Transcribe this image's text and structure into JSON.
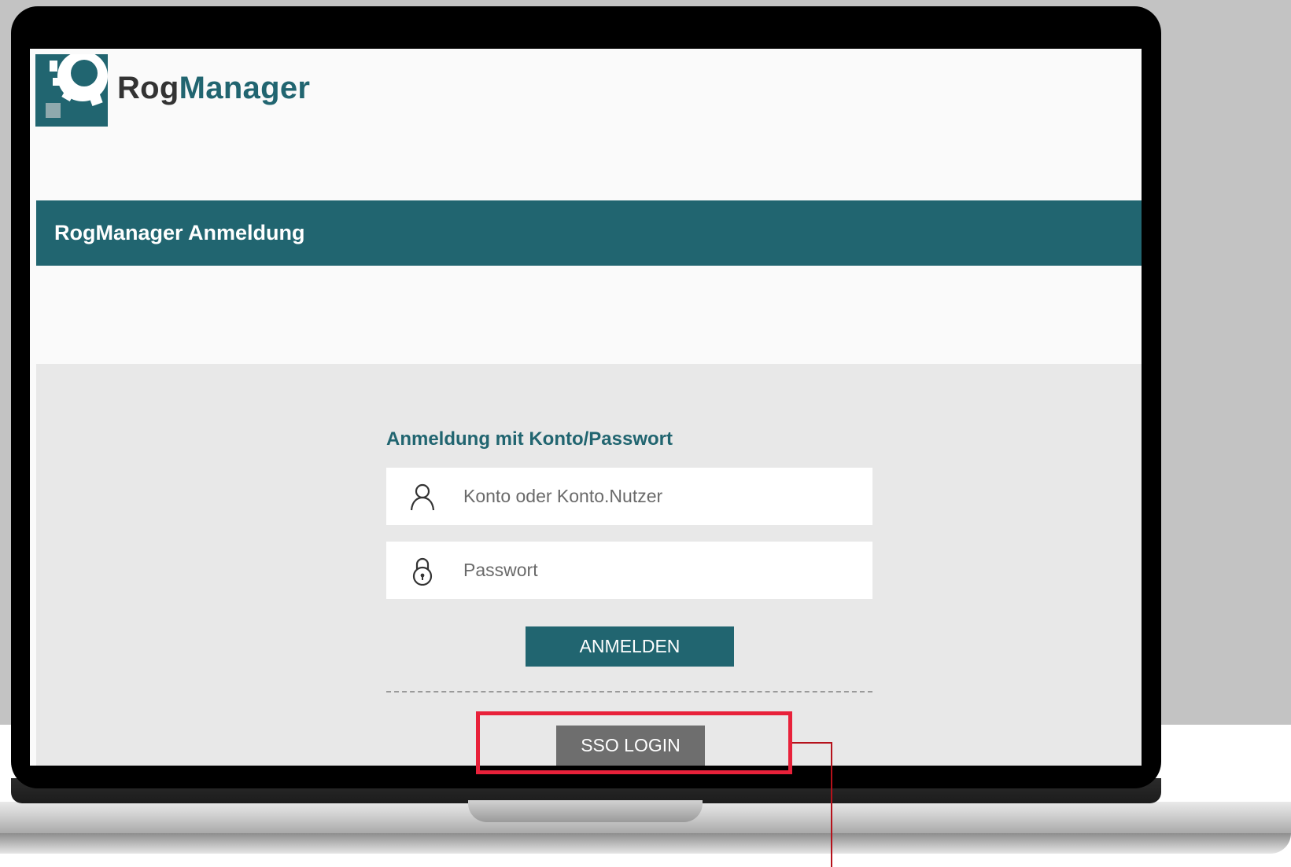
{
  "app": {
    "brand_part1": "Rog",
    "brand_part2": "Manager",
    "logo_icon": "gear-logo-icon"
  },
  "banner": {
    "title": "RogManager Anmeldung"
  },
  "login": {
    "section_title": "Anmeldung mit Konto/Passwort",
    "username": {
      "placeholder": "Konto oder Konto.Nutzer",
      "value": "",
      "icon": "user-icon"
    },
    "password": {
      "placeholder": "Passwort",
      "value": "",
      "icon": "lock-icon"
    },
    "submit_label": "ANMELDEN",
    "sso_label": "SSO LOGIN"
  },
  "colors": {
    "accent": "#216570",
    "sso_button": "#6e6e6e",
    "highlight": "#e8213a"
  }
}
